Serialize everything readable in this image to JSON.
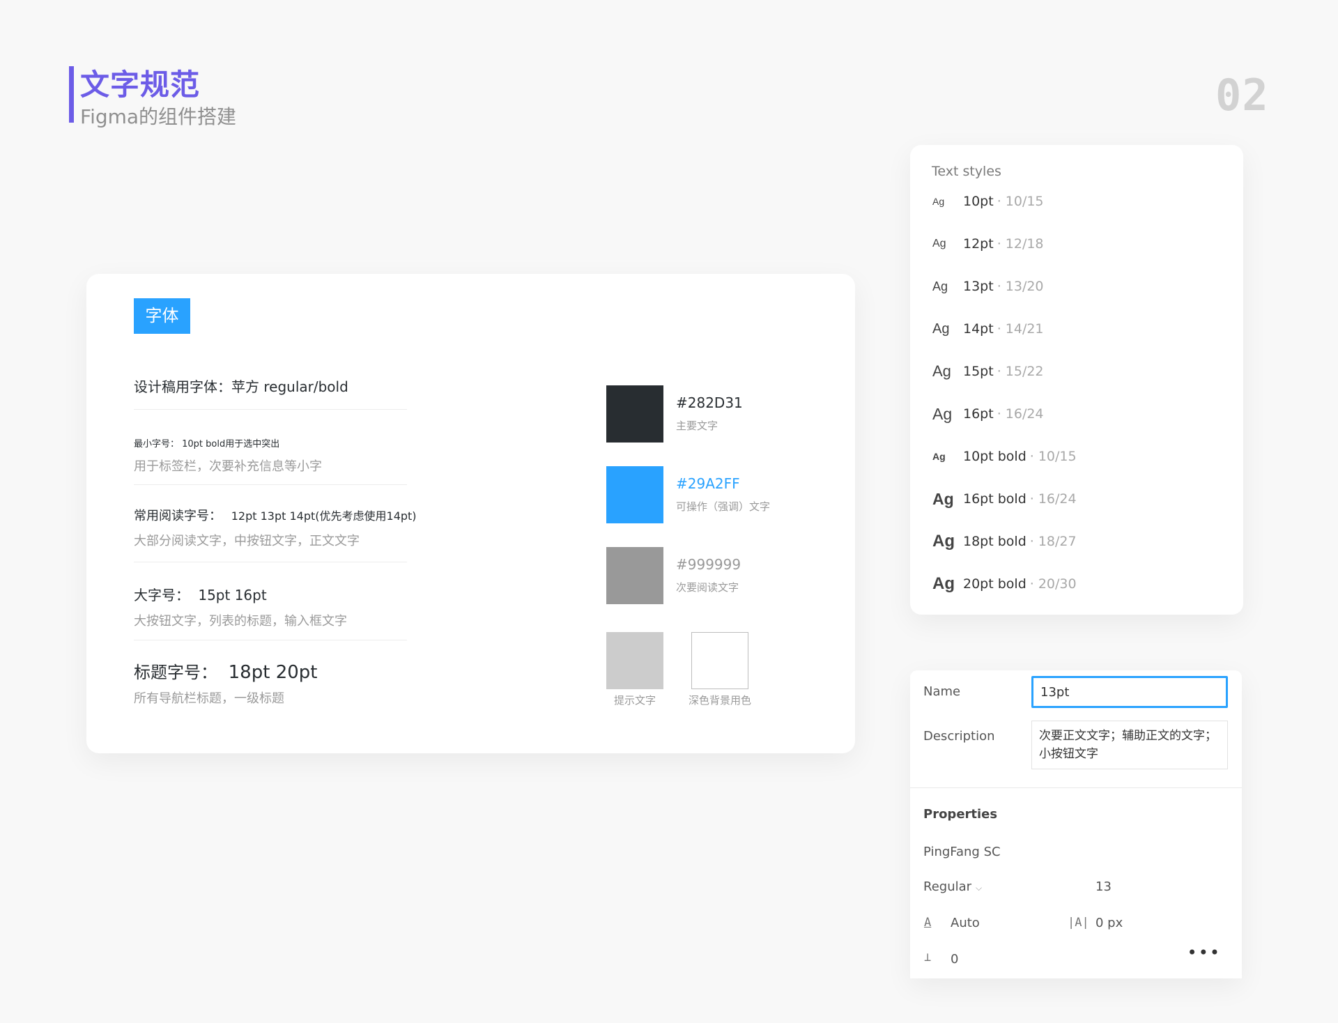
{
  "header": {
    "title": "文字规范",
    "subtitle": "Figma的组件搭建",
    "page_number": "02"
  },
  "main_card": {
    "tag": "字体",
    "rules": [
      {
        "primary": "设计稿用字体：苹方   regular/bold",
        "secondary": ""
      },
      {
        "primary": "最小字号：  10pt    bold用于选中突出",
        "secondary": "用于标签栏，次要补充信息等小字"
      },
      {
        "primary": "常用阅读字号：",
        "sizes": "12pt     13pt     14pt(优先考虑使用14pt)",
        "secondary": "大部分阅读文字，中按钮文字，正文文字"
      },
      {
        "primary": "大字号：",
        "sizes": "15pt  16pt",
        "secondary": "大按钮文字，列表的标题，输入框文字"
      },
      {
        "primary": "标题字号：",
        "sizes": "18pt  20pt",
        "secondary": "所有导航栏标题，一级标题"
      }
    ],
    "colors": [
      {
        "hex": "#282D31",
        "note": "主要文字",
        "color": "#282D31"
      },
      {
        "hex": "#29A2FF",
        "note": "可操作（强调）文字",
        "color": "#29A2FF"
      },
      {
        "hex": "#999999",
        "note": "次要阅读文字",
        "color": "#999999"
      }
    ],
    "extra_swatches": [
      {
        "caption": "提示文字",
        "color": "#CCCCCC"
      },
      {
        "caption": "深色背景用色",
        "color": "#FFFFFF"
      }
    ]
  },
  "text_styles": {
    "title": "Text styles",
    "items": [
      {
        "ag": "Ag",
        "name": "10pt",
        "detail": "· 10/15",
        "ag_size": 14,
        "bold": false
      },
      {
        "ag": "Ag",
        "name": "12pt",
        "detail": "· 12/18",
        "ag_size": 16,
        "bold": false
      },
      {
        "ag": "Ag",
        "name": "13pt",
        "detail": "· 13/20",
        "ag_size": 18,
        "bold": false
      },
      {
        "ag": "Ag",
        "name": "14pt",
        "detail": "· 14/21",
        "ag_size": 20,
        "bold": false
      },
      {
        "ag": "Ag",
        "name": "15pt",
        "detail": "· 15/22",
        "ag_size": 22,
        "bold": false
      },
      {
        "ag": "Ag",
        "name": "16pt",
        "detail": "· 16/24",
        "ag_size": 23,
        "bold": false
      },
      {
        "ag": "Ag",
        "name": "10pt bold",
        "detail": "· 10/15",
        "ag_size": 14,
        "bold": true
      },
      {
        "ag": "Ag",
        "name": "16pt bold",
        "detail": "· 16/24",
        "ag_size": 23,
        "bold": true
      },
      {
        "ag": "Ag",
        "name": "18pt bold",
        "detail": "· 18/27",
        "ag_size": 24,
        "bold": true
      },
      {
        "ag": "Ag",
        "name": "20pt bold",
        "detail": "· 20/30",
        "ag_size": 24,
        "bold": true
      }
    ]
  },
  "properties_panel": {
    "name_label": "Name",
    "name_value": "13pt",
    "description_label": "Description",
    "description_value": "次要正文文字；辅助正文的文字；小按钮文字",
    "properties_heading": "Properties",
    "font_family": "PingFang SC",
    "font_weight": "Regular",
    "font_size": "13",
    "line_height": "Auto",
    "letter_spacing": "0 px",
    "paragraph_spacing": "0"
  }
}
